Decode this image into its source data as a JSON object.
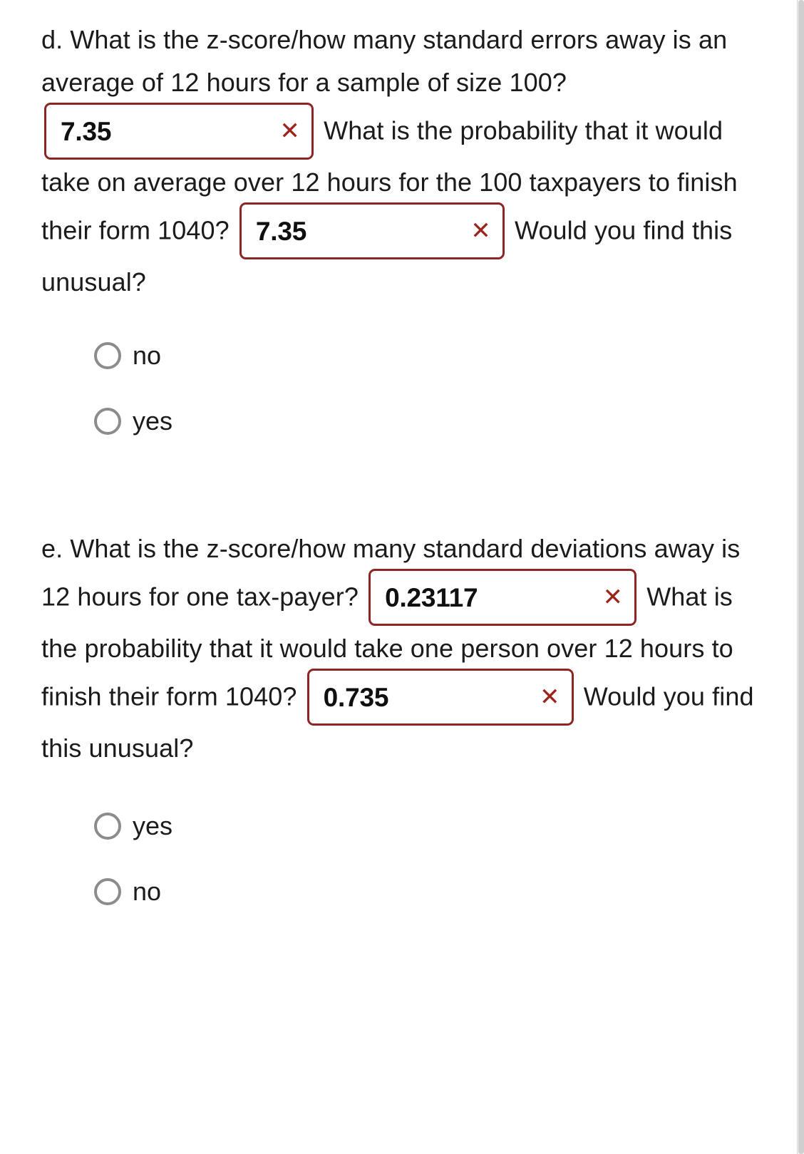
{
  "parts": [
    {
      "id": "d",
      "segments": [
        {
          "type": "text",
          "value": "d. What is the z-score/how many standard errors away is an average of 12 hours for a sample of size 100? "
        },
        {
          "type": "field",
          "key": "field_d1"
        },
        {
          "type": "text",
          "value": " What is the probability that it would take on average over 12 hours for the 100 taxpayers to finish their form 1040? "
        },
        {
          "type": "field",
          "key": "field_d2"
        },
        {
          "type": "text",
          "value": " Would you find this unusual?"
        }
      ],
      "text_1": "d. What is the z-score/how many standard errors away is an average of 12 hours for a sample of size 100?",
      "text_2": "What is the probability that it would take on average over 12 hours for the 100 taxpayers to finish their form 1040?",
      "text_3": "Would you find this unusual?",
      "field_1": {
        "value": "7.35",
        "status_icon": "x-mark-incorrect"
      },
      "field_2": {
        "value": "7.35",
        "status_icon": "x-mark-incorrect"
      },
      "radio_options": [
        {
          "label": "no",
          "selected": false
        },
        {
          "label": "yes",
          "selected": false
        }
      ]
    },
    {
      "id": "e",
      "text_1": "e. What is the z-score/how many standard deviations away is 12 hours for one tax-payer?",
      "text_2": "What is the probability that it would take one person over 12 hours to finish their form 1040?",
      "text_3": "Would you find this unusual?",
      "field_1": {
        "value": "0.23117",
        "status_icon": "x-mark-incorrect"
      },
      "field_2": {
        "value": "0.735",
        "status_icon": "x-mark-incorrect"
      },
      "radio_options": [
        {
          "label": "yes",
          "selected": false
        },
        {
          "label": "no",
          "selected": false
        }
      ]
    }
  ],
  "icons": {
    "x_mark": "✕"
  },
  "colors": {
    "incorrect_border": "#8b2622",
    "incorrect_mark": "#9c241c",
    "radio_outline": "#8c8c8c",
    "text": "#1b1b1b",
    "background": "#ffffff",
    "scrollbar_thumb": "#cfcfcf"
  }
}
